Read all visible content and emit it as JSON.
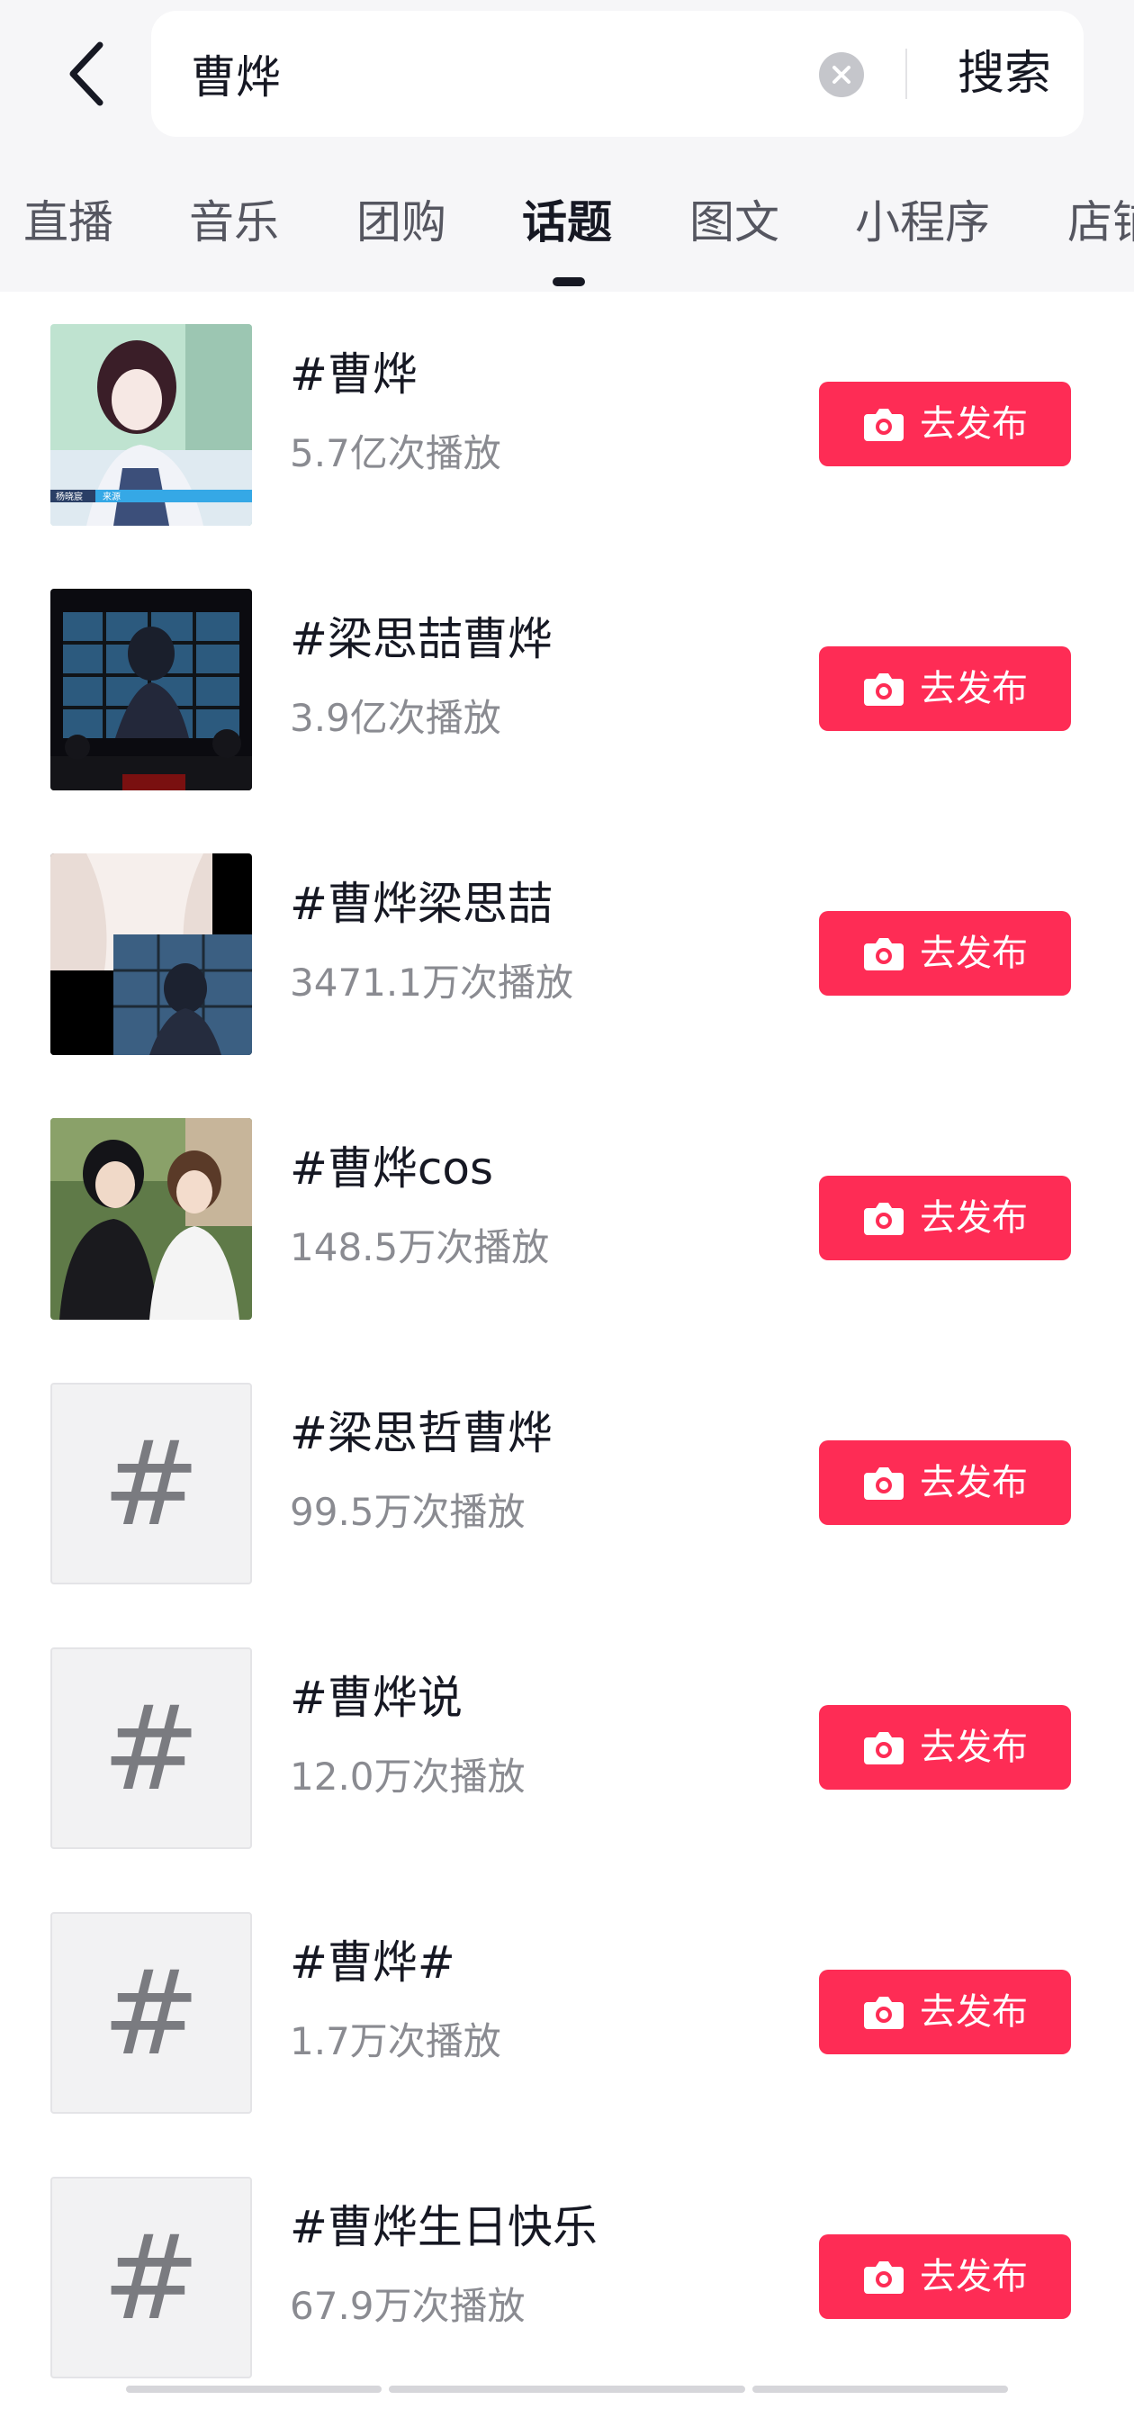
{
  "search": {
    "query": "曹烨",
    "button_label": "搜索"
  },
  "tabs": [
    {
      "label": "直播",
      "active": false
    },
    {
      "label": "音乐",
      "active": false
    },
    {
      "label": "团购",
      "active": false
    },
    {
      "label": "话题",
      "active": true
    },
    {
      "label": "图文",
      "active": false
    },
    {
      "label": "小程序",
      "active": false
    },
    {
      "label": "店铺",
      "active": false
    }
  ],
  "topics": [
    {
      "title": "#曹烨",
      "plays": "5.7亿次播放",
      "thumb": "photo",
      "button": "去发布"
    },
    {
      "title": "#梁思喆曹烨",
      "plays": "3.9亿次播放",
      "thumb": "photo",
      "button": "去发布"
    },
    {
      "title": "#曹烨梁思喆",
      "plays": "3471.1万次播放",
      "thumb": "photo",
      "button": "去发布"
    },
    {
      "title": "#曹烨cos",
      "plays": "148.5万次播放",
      "thumb": "photo",
      "button": "去发布"
    },
    {
      "title": "#梁思哲曹烨",
      "plays": "99.5万次播放",
      "thumb": "hash-placeholder",
      "button": "去发布"
    },
    {
      "title": "#曹烨说",
      "plays": "12.0万次播放",
      "thumb": "hash-placeholder",
      "button": "去发布"
    },
    {
      "title": "#曹烨#",
      "plays": "1.7万次播放",
      "thumb": "hash-placeholder",
      "button": "去发布"
    },
    {
      "title": "#曹烨生日快乐",
      "plays": "67.9万次播放",
      "thumb": "hash-placeholder",
      "button": "去发布"
    }
  ],
  "thumb_overlay": {
    "left_caption": "杨晓宸",
    "right_caption": "来源"
  },
  "hash_glyph": "#",
  "colors": {
    "accent": "#fe2c55",
    "header_bg": "#f6f6f8",
    "text_primary": "#161823",
    "text_secondary": "#8a8b91"
  },
  "icons": {
    "back": "chevron-left-icon",
    "clear": "clear-circle-icon",
    "publish": "camera-icon"
  }
}
